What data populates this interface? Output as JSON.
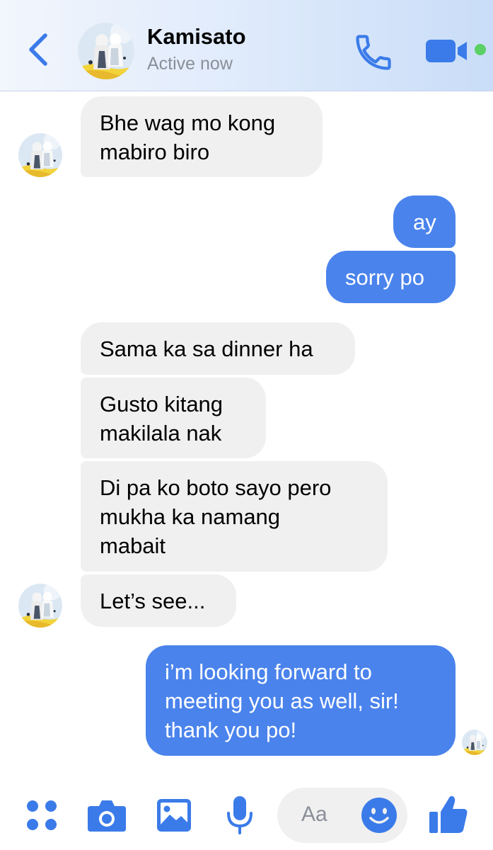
{
  "header": {
    "contact_name": "Kamisato",
    "status": "Active now"
  },
  "messages": [
    {
      "side": "incoming",
      "text": "Bhe wag mo kong\nmabiro biro"
    },
    {
      "side": "outgoing",
      "text": "ay"
    },
    {
      "side": "outgoing",
      "text": "sorry po"
    },
    {
      "side": "incoming",
      "text": "Sama ka sa dinner ha"
    },
    {
      "side": "incoming",
      "text": "Gusto kitang\nmakilala nak"
    },
    {
      "side": "incoming",
      "text": "Di pa ko boto sayo pero\nmukha ka namang\nmabait"
    },
    {
      "side": "incoming",
      "text": "Let’s see..."
    },
    {
      "side": "outgoing",
      "text": "i’m looking forward to\nmeeting you as well, sir!\nthank you po!"
    }
  ],
  "composer": {
    "placeholder": "Aa"
  },
  "icons": {
    "back": "chevron-left-icon",
    "call": "phone-icon",
    "video": "video-camera-icon",
    "apps": "four-dots-icon",
    "camera": "camera-icon",
    "gallery": "image-icon",
    "voice": "microphone-icon",
    "emoji": "smiley-icon",
    "like": "thumbs-up-icon"
  },
  "colors": {
    "accent": "#4a83ec",
    "incoming_bubble": "#f0f0f0",
    "outgoing_bubble": "#4a83ec",
    "active_dot": "#5bd064"
  }
}
